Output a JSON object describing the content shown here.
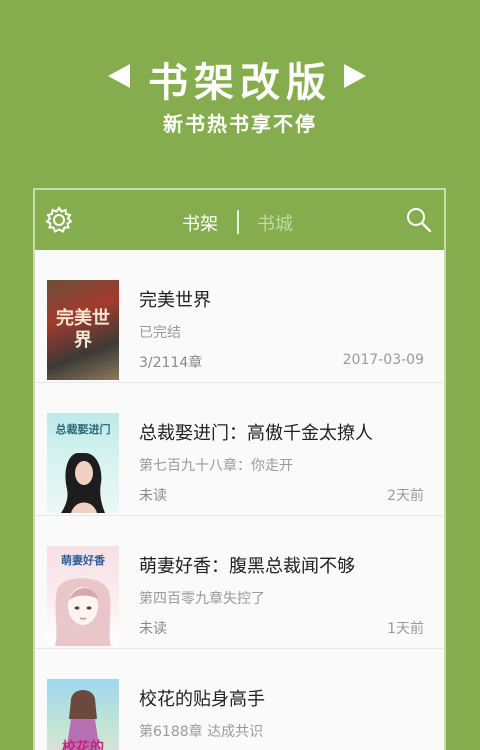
{
  "hero": {
    "title": "书架改版",
    "subtitle": "新书热书享不停"
  },
  "topbar": {
    "tabs": [
      {
        "label": "书架",
        "active": true
      },
      {
        "label": "书城",
        "active": false
      }
    ],
    "colors": {
      "bar": "#86ad4d",
      "inactive_tab": "#c5d9a4"
    }
  },
  "books": [
    {
      "title": "完美世界",
      "subtitle": "已完结",
      "progress": "3/2114章",
      "time": "2017-03-09",
      "cover_text": "完美世界"
    },
    {
      "title": "总裁娶进门：高傲千金太撩人",
      "subtitle": "第七百九十八章：你走开",
      "progress": "未读",
      "time": "2天前",
      "cover_text": "总裁娶进门"
    },
    {
      "title": "萌妻好香：腹黑总裁闻不够",
      "subtitle": "第四百零九章失控了",
      "progress": "未读",
      "time": "1天前",
      "cover_text": "萌妻好香"
    },
    {
      "title": "校花的贴身高手",
      "subtitle": "第6188章 达成共识",
      "progress": "",
      "time": "",
      "cover_text": "校花的"
    }
  ]
}
